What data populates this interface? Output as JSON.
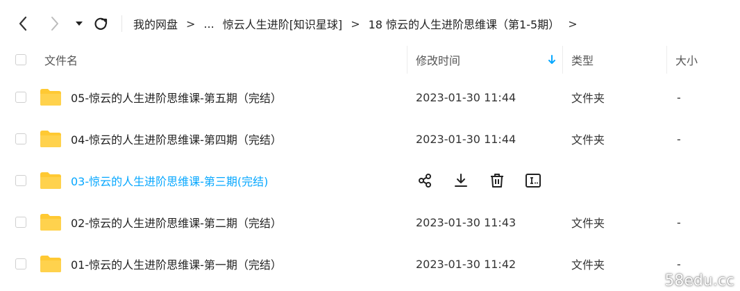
{
  "breadcrumb": {
    "root": "我的网盘",
    "separator": ">",
    "ellipsis": "...",
    "items": [
      "惊云人生进阶[知识星球]",
      "18 惊云的人生进阶思维课（第1-5期）"
    ]
  },
  "header": {
    "name": "文件名",
    "modified": "修改时间",
    "type": "类型",
    "size": "大小"
  },
  "files": [
    {
      "name": "05-惊云的人生进阶思维课-第五期（完结）",
      "modified": "2023-01-30 11:44",
      "type": "文件夹",
      "size": "-"
    },
    {
      "name": "04-惊云的人生进阶思维课-第四期（完结）",
      "modified": "2023-01-30 11:44",
      "type": "文件夹",
      "size": "-"
    },
    {
      "name": "03-惊云的人生进阶思维课-第三期(完结)",
      "modified": "",
      "type": "",
      "size": ""
    },
    {
      "name": "02-惊云的人生进阶思维课-第二期（完结）",
      "modified": "2023-01-30 11:43",
      "type": "文件夹",
      "size": "-"
    },
    {
      "name": "01-惊云的人生进阶思维课-第一期（完结）",
      "modified": "2023-01-30 11:42",
      "type": "文件夹",
      "size": "-"
    }
  ],
  "colors": {
    "accent": "#06a7ff",
    "folder": "#ffc933"
  },
  "icons": {
    "share": "share-icon",
    "download": "download-icon",
    "delete": "trash-icon",
    "rename": "rename-icon"
  },
  "watermark": "58edu.cc"
}
